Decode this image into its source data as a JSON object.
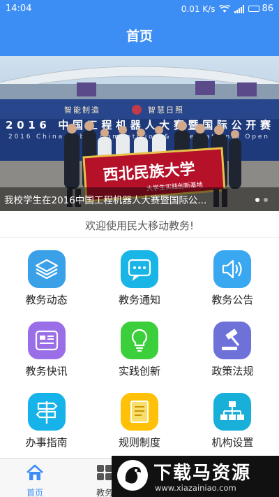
{
  "status_bar": {
    "time": "14:04",
    "speed": "0.01 K/s",
    "battery": "86",
    "battery_level": 0.86
  },
  "header": {
    "title": "首页"
  },
  "banner": {
    "caption": "我校学生在2016中国工程机器人大赛暨国际公...",
    "slide_count": 2,
    "active_slide": 0,
    "photo_text": {
      "stadium_sign_left": "智能制造",
      "stadium_sign_right": "智慧日照",
      "event_title": "2016 中国工程机器人大赛暨国际公开赛",
      "event_subtitle": "2016 China Robot Competition & International Open",
      "banner_main": "西北民族大学",
      "banner_sub": "大学生实践创新基地"
    }
  },
  "welcome": {
    "text": "欢迎使用民大移动教务!"
  },
  "grid": [
    {
      "label": "教务动态",
      "icon": "layers-icon",
      "color": "#3aa0e8"
    },
    {
      "label": "教务通知",
      "icon": "chat-icon",
      "color": "#18b5e6"
    },
    {
      "label": "教务公告",
      "icon": "speaker-icon",
      "color": "#3aa8f0"
    },
    {
      "label": "教务快讯",
      "icon": "news-icon",
      "color": "#9a6ee6"
    },
    {
      "label": "实践创新",
      "icon": "lightbulb-icon",
      "color": "#3ccf3c"
    },
    {
      "label": "政策法规",
      "icon": "gavel-icon",
      "color": "#6e72d8"
    },
    {
      "label": "办事指南",
      "icon": "signpost-icon",
      "color": "#16b2ea"
    },
    {
      "label": "规则制度",
      "icon": "document-icon",
      "color": "#ffc107"
    },
    {
      "label": "机构设置",
      "icon": "org-chart-icon",
      "color": "#18b0d8"
    }
  ],
  "tabbar": {
    "tabs": [
      {
        "label": "首页",
        "icon": "home-icon",
        "active": true
      },
      {
        "label": "教务",
        "icon": "grid-icon",
        "active": false
      }
    ]
  },
  "watermark": {
    "main": "下载马资源",
    "url": "www.xiazainiao.com"
  }
}
